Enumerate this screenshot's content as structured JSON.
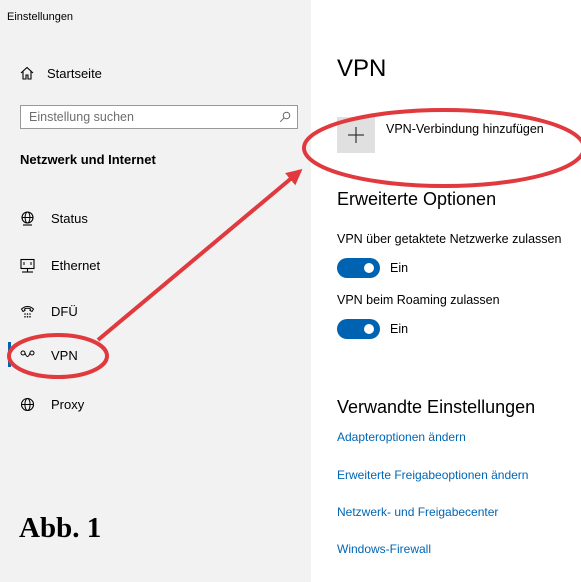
{
  "window": {
    "title": "Einstellungen"
  },
  "sidebar": {
    "home_label": "Startseite",
    "search_placeholder": "Einstellung suchen",
    "section_title": "Netzwerk und Internet",
    "items": [
      {
        "label": "Status",
        "icon": "globe-status-icon"
      },
      {
        "label": "Ethernet",
        "icon": "ethernet-icon"
      },
      {
        "label": "DFÜ",
        "icon": "dialup-icon"
      },
      {
        "label": "VPN",
        "icon": "vpn-icon",
        "selected": true
      },
      {
        "label": "Proxy",
        "icon": "globe-icon"
      }
    ]
  },
  "main": {
    "title": "VPN",
    "add_vpn_label": "VPN-Verbindung hinzufügen",
    "advanced": {
      "heading": "Erweiterte Optionen",
      "options": [
        {
          "label": "VPN über getaktete Netzwerke zulassen",
          "state": "Ein",
          "on": true
        },
        {
          "label": "VPN beim Roaming zulassen",
          "state": "Ein",
          "on": true
        }
      ]
    },
    "related": {
      "heading": "Verwandte Einstellungen",
      "links": [
        "Adapteroptionen ändern",
        "Erweiterte Freigabeoptionen ändern",
        "Netzwerk- und Freigabecenter",
        "Windows-Firewall"
      ]
    }
  },
  "annotation": {
    "figure_label": "Abb. 1",
    "color": "#e0393e"
  },
  "colors": {
    "accent": "#0063b1",
    "link": "#0066b4",
    "sidebar_bg": "#f2f2f2"
  }
}
